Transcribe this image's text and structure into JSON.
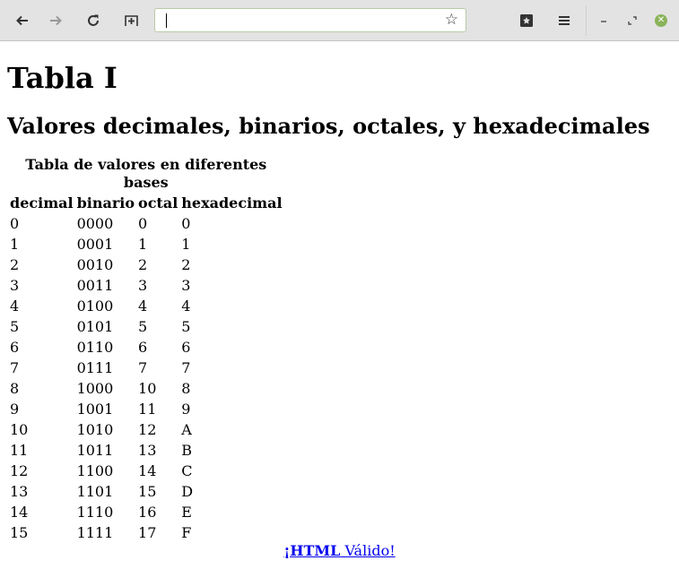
{
  "page": {
    "title": "Tabla I",
    "subtitle": "Valores decimales, binarios, octales, y hexadecimales"
  },
  "table": {
    "caption": "Tabla de valores en diferentes bases",
    "headers": [
      "decimal",
      "binario",
      "octal",
      "hexadecimal"
    ],
    "rows": [
      [
        "0",
        "0000",
        "0",
        "0"
      ],
      [
        "1",
        "0001",
        "1",
        "1"
      ],
      [
        "2",
        "0010",
        "2",
        "2"
      ],
      [
        "3",
        "0011",
        "3",
        "3"
      ],
      [
        "4",
        "0100",
        "4",
        "4"
      ],
      [
        "5",
        "0101",
        "5",
        "5"
      ],
      [
        "6",
        "0110",
        "6",
        "6"
      ],
      [
        "7",
        "0111",
        "7",
        "7"
      ],
      [
        "8",
        "1000",
        "10",
        "8"
      ],
      [
        "9",
        "1001",
        "11",
        "9"
      ],
      [
        "10",
        "1010",
        "12",
        "A"
      ],
      [
        "11",
        "1011",
        "13",
        "B"
      ],
      [
        "12",
        "1100",
        "14",
        "C"
      ],
      [
        "13",
        "1101",
        "15",
        "D"
      ],
      [
        "14",
        "1110",
        "16",
        "E"
      ],
      [
        "15",
        "1111",
        "17",
        "F"
      ]
    ]
  },
  "footer": {
    "link_bold": "¡HTML",
    "link_rest": " Válido!"
  },
  "toolbar": {
    "address_value": "",
    "icons": [
      "back-icon",
      "forward-icon",
      "reload-icon",
      "new-tab-icon",
      "bookmark-star-icon",
      "reader-icon",
      "menu-icon",
      "minimize-icon",
      "restore-icon",
      "close-icon"
    ]
  },
  "colors": {
    "chrome_bg": "#e3e3e3",
    "link": "#0000ee",
    "close_button": "#8ab35b"
  }
}
